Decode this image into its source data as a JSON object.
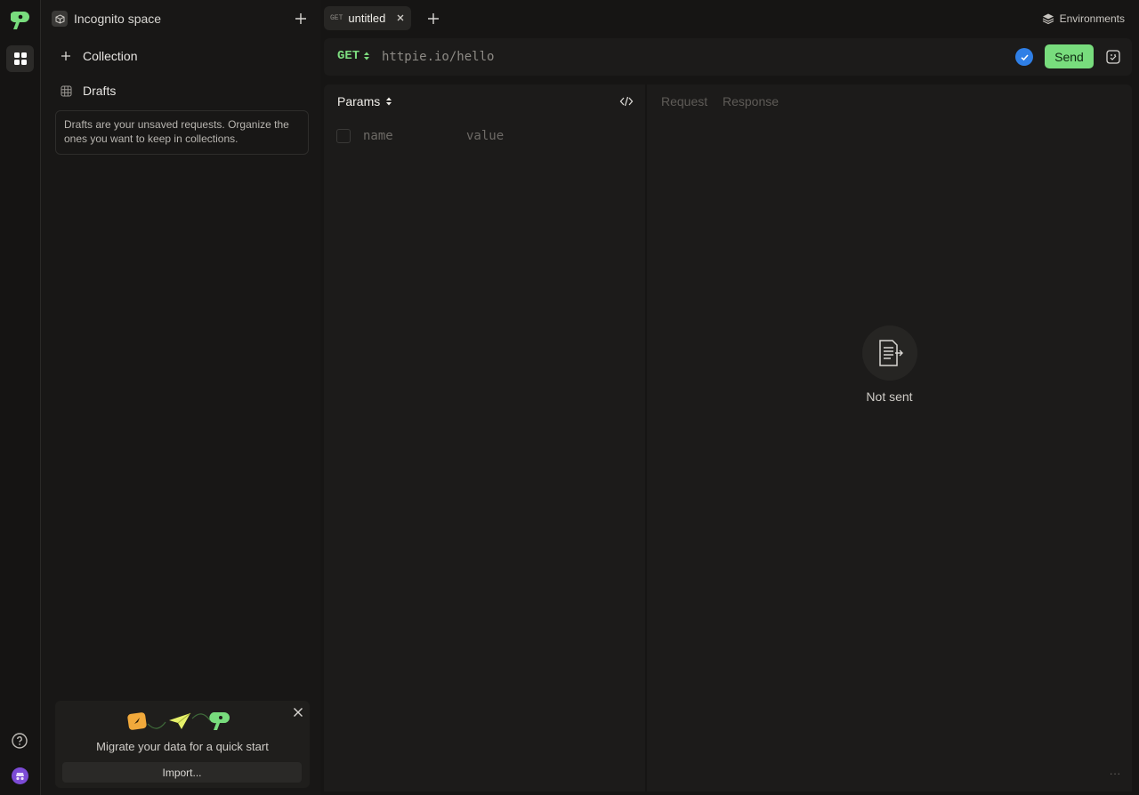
{
  "sidebar": {
    "space_title": "Incognito space",
    "items": [
      {
        "label": "Collection",
        "icon": "plus-icon"
      },
      {
        "label": "Drafts",
        "icon": "grid-icon"
      }
    ],
    "drafts_note": "Drafts are your unsaved requests. Organize the ones you want to keep in collections.",
    "migrate": {
      "text": "Migrate your data for a quick start",
      "import_label": "Import..."
    }
  },
  "tabs": [
    {
      "method": "GET",
      "title": "untitled"
    }
  ],
  "environments_label": "Environments",
  "request": {
    "method": "GET",
    "url_placeholder": "httpie.io/hello",
    "send_label": "Send"
  },
  "params": {
    "title": "Params",
    "name_placeholder": "name",
    "value_placeholder": "value"
  },
  "response": {
    "tabs": [
      "Request",
      "Response"
    ],
    "empty_text": "Not sent",
    "more": "..."
  },
  "colors": {
    "accent_green": "#78dc7d",
    "check_blue": "#2f7fe6",
    "background": "#161514"
  }
}
